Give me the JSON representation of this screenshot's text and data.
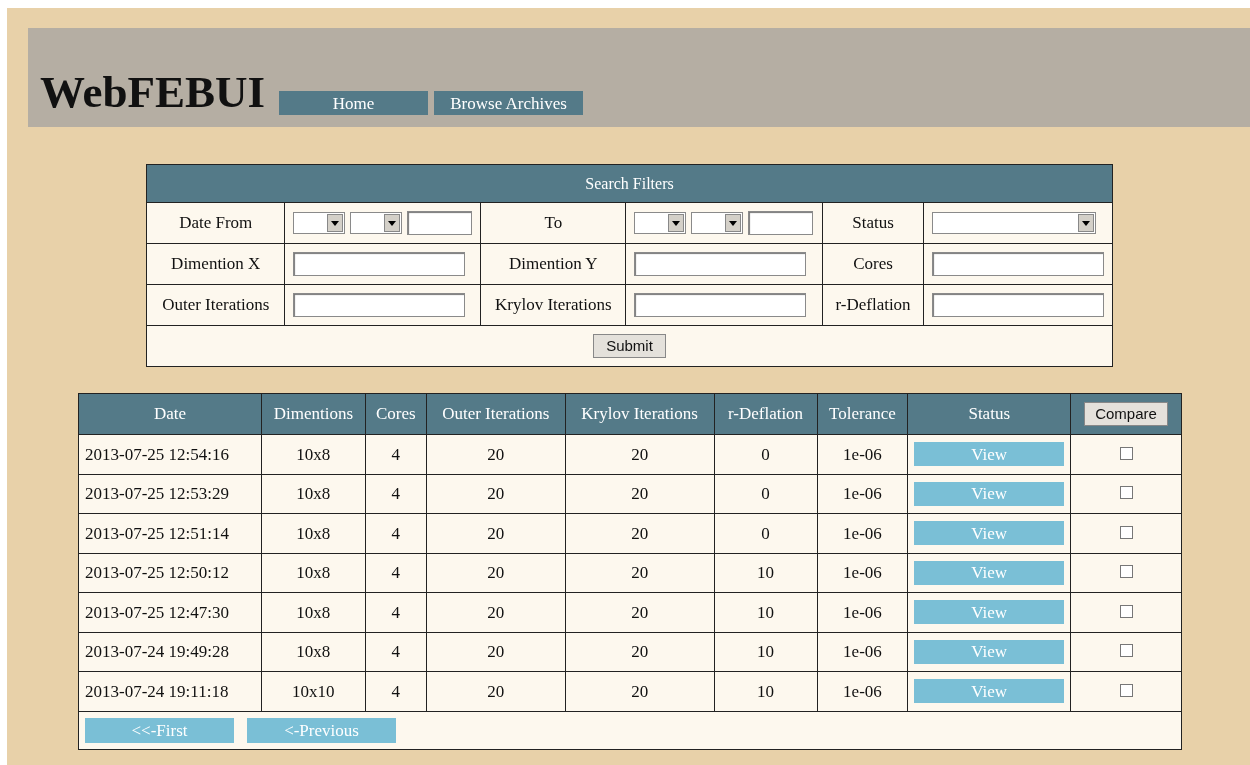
{
  "header": {
    "title": "WebFEBUI",
    "nav": [
      {
        "label": "Home"
      },
      {
        "label": "Browse Archives"
      }
    ]
  },
  "filters": {
    "title": "Search Filters",
    "fields": [
      {
        "label": "Date From",
        "kind": "date"
      },
      {
        "label": "To",
        "kind": "date"
      },
      {
        "label": "Status",
        "kind": "select"
      },
      {
        "label": "Dimention X",
        "kind": "text"
      },
      {
        "label": "Dimention Y",
        "kind": "text"
      },
      {
        "label": "Cores",
        "kind": "text"
      },
      {
        "label": "Outer Iterations",
        "kind": "text"
      },
      {
        "label": "Krylov Iterations",
        "kind": "text"
      },
      {
        "label": "r-Deflation",
        "kind": "text"
      }
    ],
    "submit": "Submit"
  },
  "results": {
    "columns": [
      {
        "label": "Date",
        "kind": "text"
      },
      {
        "label": "Dimentions",
        "kind": "text"
      },
      {
        "label": "Cores",
        "kind": "text"
      },
      {
        "label": "Outer Iterations",
        "kind": "text"
      },
      {
        "label": "Krylov Iterations",
        "kind": "text"
      },
      {
        "label": "r-Deflation",
        "kind": "text"
      },
      {
        "label": "Tolerance",
        "kind": "text"
      },
      {
        "label": "Status",
        "kind": "text"
      },
      {
        "label": "Compare",
        "kind": "button"
      }
    ],
    "rows": [
      {
        "cells": [
          "2013-07-25 12:54:16",
          "10x8",
          "4",
          "20",
          "20",
          "0",
          "1e-06"
        ],
        "status": "View",
        "checked": false
      },
      {
        "cells": [
          "2013-07-25 12:53:29",
          "10x8",
          "4",
          "20",
          "20",
          "0",
          "1e-06"
        ],
        "status": "View",
        "checked": false
      },
      {
        "cells": [
          "2013-07-25 12:51:14",
          "10x8",
          "4",
          "20",
          "20",
          "0",
          "1e-06"
        ],
        "status": "View",
        "checked": false
      },
      {
        "cells": [
          "2013-07-25 12:50:12",
          "10x8",
          "4",
          "20",
          "20",
          "10",
          "1e-06"
        ],
        "status": "View",
        "checked": false
      },
      {
        "cells": [
          "2013-07-25 12:47:30",
          "10x8",
          "4",
          "20",
          "20",
          "10",
          "1e-06"
        ],
        "status": "View",
        "checked": false
      },
      {
        "cells": [
          "2013-07-24 19:49:28",
          "10x8",
          "4",
          "20",
          "20",
          "10",
          "1e-06"
        ],
        "status": "View",
        "checked": false
      },
      {
        "cells": [
          "2013-07-24 19:11:18",
          "10x10",
          "4",
          "20",
          "20",
          "10",
          "1e-06"
        ],
        "status": "View",
        "checked": false
      }
    ],
    "pager": [
      {
        "label": "<<-First"
      },
      {
        "label": "<-Previous"
      }
    ]
  }
}
